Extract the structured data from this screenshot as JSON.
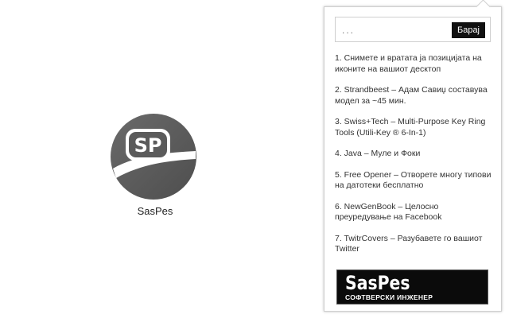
{
  "logo": {
    "monogram": "SP",
    "caption": "SasPes"
  },
  "popup": {
    "search": {
      "value": "...",
      "placeholder": "...",
      "button_label": "Барај"
    },
    "items": [
      {
        "label": "1. Снимете и вратата ја позицијата на иконите на вашиот десктоп"
      },
      {
        "label": "2. Strandbeest – Адам Савиџ составува модел за ~45 мин."
      },
      {
        "label": "3. Swiss+Tech – Multi-Purpose Key Ring Tools (Utili-Key ® 6-In-1)"
      },
      {
        "label": "4. Java – Муле и Фоки"
      },
      {
        "label": "5. Free Opener – Отворете многу типови на датотеки бесплатно"
      },
      {
        "label": "6. NewGenBook – Целосно преуредување на Facebook"
      },
      {
        "label": "7. TwitrCovers – Разубавете го вашиот Twitter"
      }
    ],
    "banner": {
      "title": "SasPes",
      "subtitle": "СОФТВЕРСКИ ИНЖЕНЕР"
    }
  },
  "colors": {
    "logo_gray": "#5f5f5f",
    "button_bg": "#111111",
    "banner_bg": "#0b0b0b"
  }
}
